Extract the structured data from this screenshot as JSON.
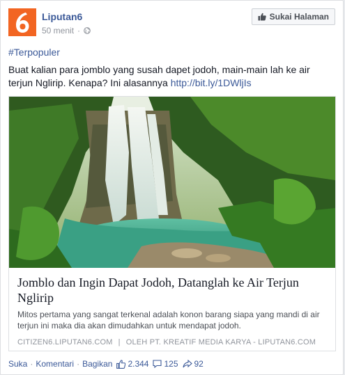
{
  "post": {
    "page_name": "Liputan6",
    "time": "50 menit",
    "separator": "·",
    "like_page_label": "Sukai Halaman",
    "hashtag": "#Terpopuler",
    "text": "Buat kalian para jomblo yang susah dapet jodoh, main-main lah ke air terjun Nglirip. Kenapa? Ini alasannya",
    "link": "http://bit.ly/1DWljIs"
  },
  "attachment": {
    "title": "Jomblo dan Ingin Dapat Jodoh, Datanglah ke Air Terjun Nglirip",
    "description": "Mitos pertama yang sangat terkenal adalah konon barang siapa yang mandi di air terjun ini maka dia akan dimudahkan untuk mendapat jodoh.",
    "source_domain": "CITIZEN6.LIPUTAN6.COM",
    "source_sep": "|",
    "source_by": "OLEH PT. KREATIF MEDIA KARYA - LIPUTAN6.COM"
  },
  "actions": {
    "like": "Suka",
    "comment": "Komentari",
    "share": "Bagikan",
    "dot": "·",
    "like_count": "2.344",
    "comment_count": "125",
    "share_count": "92"
  },
  "colors": {
    "brand_orange": "#f26522",
    "link_blue": "#3b5998",
    "muted": "#90949c"
  },
  "icons": {
    "logo": "liputan6-logo",
    "globe": "globe-icon",
    "like_page": "thumbs-up-icon",
    "like_stat": "thumbs-up-icon",
    "comment_stat": "comment-icon",
    "share_stat": "share-icon"
  }
}
